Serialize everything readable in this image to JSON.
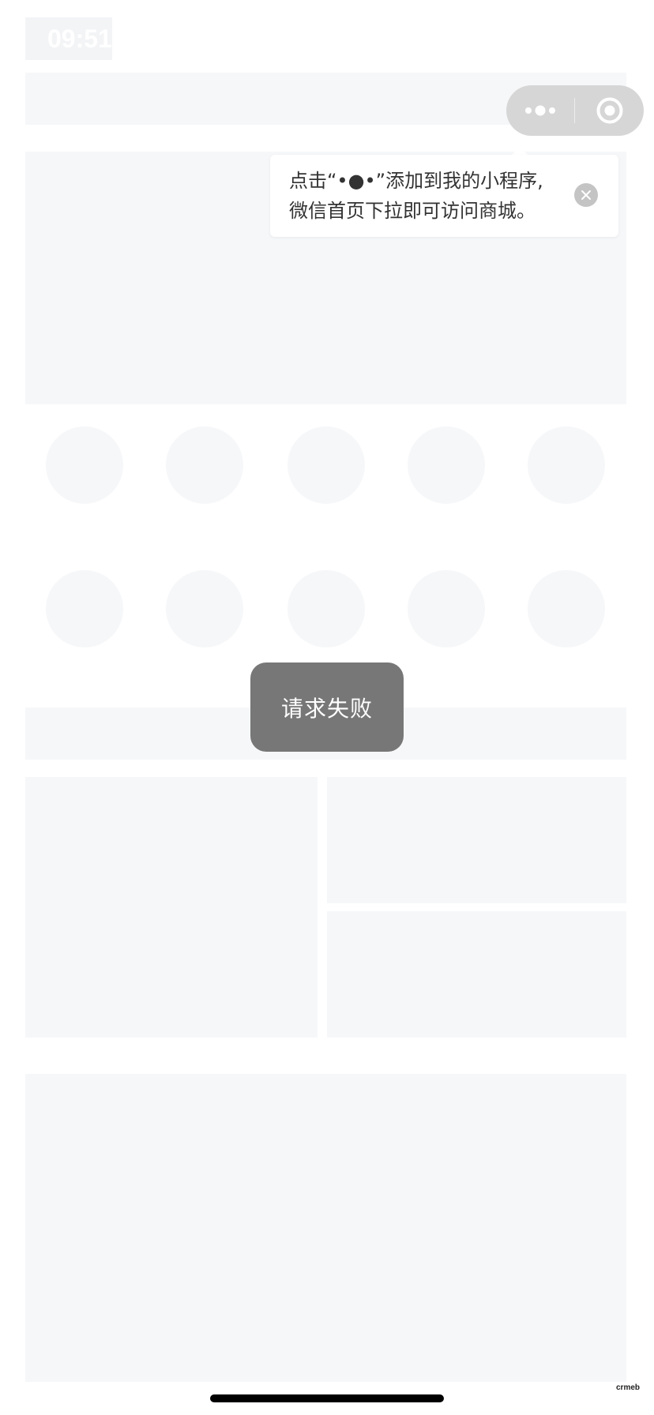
{
  "status_bar": {
    "time": "09:51"
  },
  "capsule": {
    "more_icon": "more-dots-icon",
    "close_icon": "target-circle-icon"
  },
  "tooltip": {
    "line1": "点击“•●•”添加到我的小程序,",
    "line2": "微信首页下拉即可访问商城。",
    "close_icon": "close-x-icon"
  },
  "toast": {
    "message": "请求失败"
  },
  "watermark": {
    "text": "crmeb"
  },
  "colors": {
    "skeleton": "#f6f7f9",
    "toast_bg": "#777777",
    "capsule_bg": "#d6d6d6",
    "tooltip_close_bg": "#c4c4c4"
  }
}
